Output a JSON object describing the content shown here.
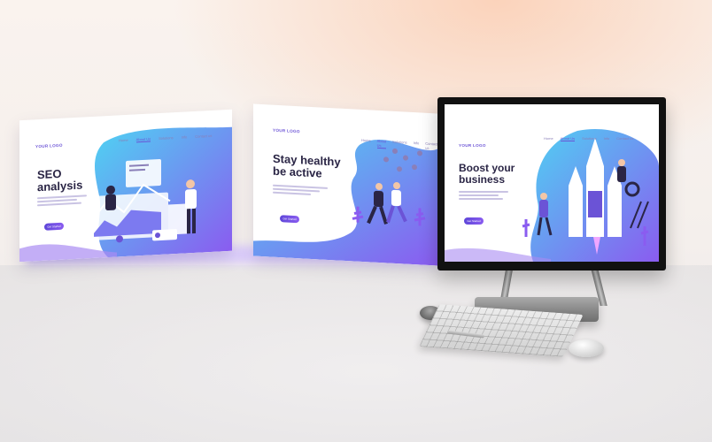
{
  "panels": [
    {
      "logo": "YOUR LOGO",
      "nav": [
        "Home",
        "About Us",
        "Solutions",
        "Info",
        "Contact us"
      ],
      "active": 1,
      "hero_lines": [
        "SEO",
        "analysis"
      ],
      "cta": "Get Started"
    },
    {
      "logo": "YOUR LOGO",
      "nav": [
        "Home",
        "About Us",
        "Solutions",
        "Info",
        "Contact us"
      ],
      "active": 1,
      "hero_lines": [
        "Stay healthy",
        "be active"
      ],
      "cta": "Get Started"
    },
    {
      "logo": "YOUR LOGO",
      "nav": [
        "Home",
        "About Us",
        "Solutions",
        "Info",
        "Contact us"
      ],
      "active": 1,
      "hero_lines": [
        "Boost your",
        "business"
      ],
      "cta": "Get Started"
    }
  ],
  "colors": {
    "accent": "#6b53d6",
    "gradient_start": "#4fd1f2",
    "gradient_end": "#8a5cf0",
    "ink": "#2a2545"
  },
  "icons": [
    "person-icon",
    "chart-icon",
    "runner-icon",
    "rocket-icon",
    "gear-icon",
    "plant-icon"
  ]
}
